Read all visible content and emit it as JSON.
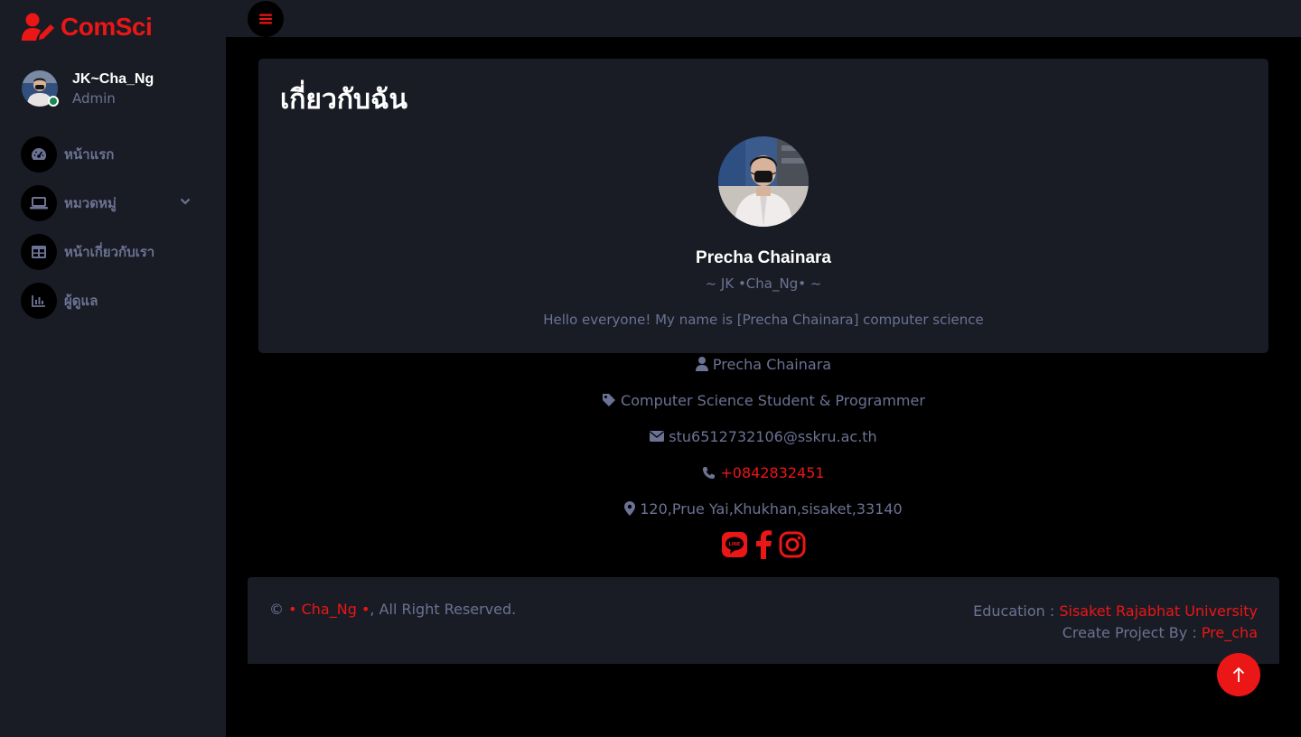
{
  "colors": {
    "accent": "#eb1616",
    "panel": "#191c24",
    "background": "#000000",
    "muted": "#6c7293",
    "online": "#198754"
  },
  "brand": {
    "name": "ComSci",
    "icon": "user-edit-icon"
  },
  "profile": {
    "name": "JK~Cha_Ng",
    "role": "Admin"
  },
  "nav": {
    "items": [
      {
        "label": "หน้าแรก",
        "icon": "tachometer-icon"
      },
      {
        "label": "หมวดหมู่",
        "icon": "laptop-icon",
        "has_submenu": true
      },
      {
        "label": "หน้าเกี่ยวกับเรา",
        "icon": "table-icon"
      },
      {
        "label": "ผู้ดูแล",
        "icon": "chart-bar-icon"
      }
    ]
  },
  "topbar": {
    "toggle_icon": "bars-icon"
  },
  "about": {
    "title": "เกี่ยวกับฉัน",
    "name": "Precha Chainara",
    "nickname": "~ JK •Cha_Ng• ~",
    "bio": "Hello everyone! My name is [Precha Chainara] computer science"
  },
  "info": {
    "name": "Precha Chainara",
    "occupation": "Computer Science Student & Programmer",
    "email": "stu6512732106@sskru.ac.th",
    "phone": "+0842832451",
    "address": "120,Prue Yai,Khukhan,sisaket,33140"
  },
  "socials": [
    "line-icon",
    "facebook-icon",
    "instagram-icon"
  ],
  "footer": {
    "copyright_symbol": "©",
    "owner": "• Cha_Ng •",
    "rights": ", All Right Reserved.",
    "education_label": "Education :",
    "education_value": "Sisaket Rajabhat University",
    "project_label": "Create Project By :",
    "project_value": "Pre_cha"
  }
}
